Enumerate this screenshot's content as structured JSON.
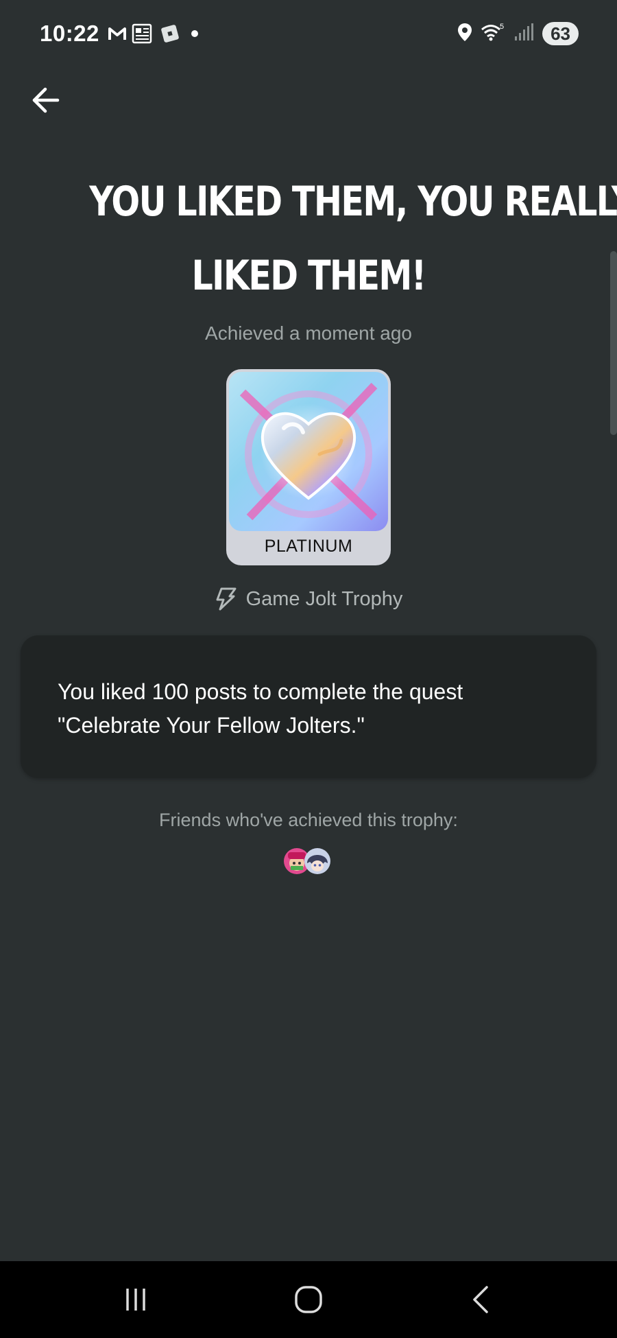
{
  "status_bar": {
    "time": "10:22",
    "battery_level": "63",
    "left_icons": [
      "gmail-icon",
      "news-icon",
      "roblox-icon",
      "dot-icon"
    ],
    "right_icons": [
      "location-icon",
      "wifi-icon",
      "signal-icon"
    ]
  },
  "header": {
    "back_icon": "arrow-left-icon"
  },
  "trophy": {
    "title_line1": "YOU LIKED THEM, YOU REALLY",
    "title_line2": "LIKED THEM!",
    "achieved": "Achieved a moment ago",
    "tier": "PLATINUM",
    "source_icon": "game-jolt-bolt-icon",
    "source": "Game Jolt Trophy",
    "description": "You liked 100 posts to complete the quest \"Celebrate Your Fellow Jolters.\""
  },
  "friends": {
    "label": "Friends who've achieved this trophy:",
    "avatars": [
      "friend-avatar-1",
      "friend-avatar-2"
    ]
  },
  "colors": {
    "background": "#2b3031",
    "card": "#202424",
    "muted_text": "#9fa6a6",
    "tier_plate": "#d2d4db"
  },
  "nav": {
    "items": [
      "recent-apps",
      "home",
      "back"
    ]
  }
}
